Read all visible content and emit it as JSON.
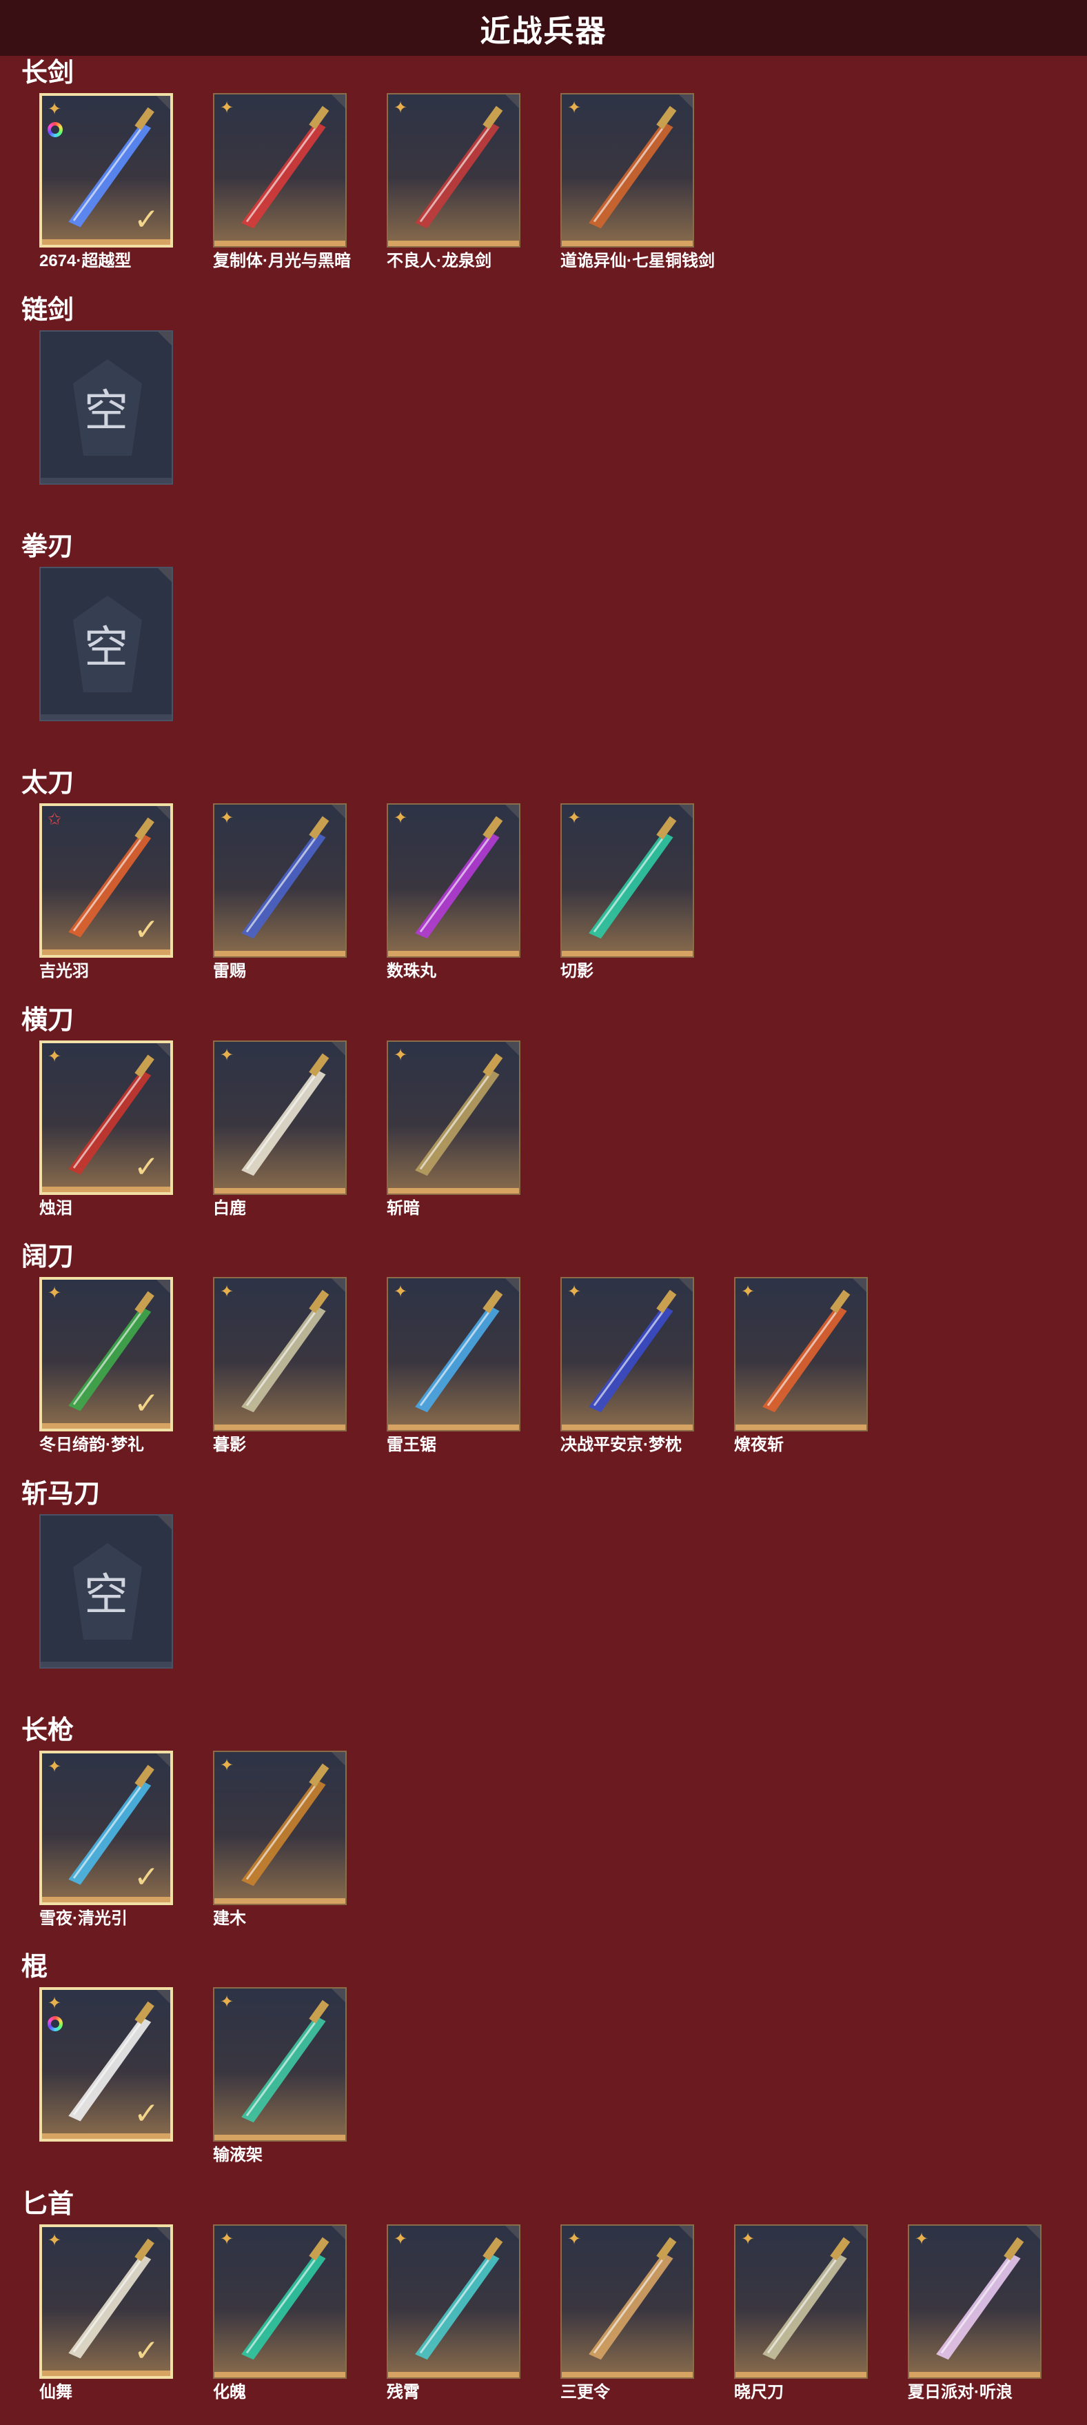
{
  "header": {
    "title": "近战兵器"
  },
  "colors": {
    "background": "#6b1b20",
    "header": "#3a0f13",
    "tile_top": "#2d3346",
    "tile_bottom_bar": "#d6a363",
    "equipped_border": "#f1dfa6"
  },
  "sections": [
    {
      "title": "长剑",
      "items": [
        {
          "name": "2674·超越型",
          "equipped": true,
          "rarity": "gold",
          "ring": true,
          "color": "#5b8cff"
        },
        {
          "name": "复制体·月光与黑暗",
          "equipped": false,
          "rarity": "gold",
          "color": "#d63a3a"
        },
        {
          "name": "不良人·龙泉剑",
          "equipped": false,
          "rarity": "gold",
          "color": "#c23b3b"
        },
        {
          "name": "道诡异仙·七星铜钱剑",
          "equipped": false,
          "rarity": "gold",
          "color": "#d0662e"
        }
      ]
    },
    {
      "title": "链剑",
      "items": [
        {
          "name": "",
          "empty": true,
          "empty_label": "空"
        }
      ]
    },
    {
      "title": "拳刃",
      "items": [
        {
          "name": "",
          "empty": true,
          "empty_label": "空"
        }
      ]
    },
    {
      "title": "太刀",
      "items": [
        {
          "name": "吉光羽",
          "equipped": true,
          "rarity": "red",
          "color": "#e0622e"
        },
        {
          "name": "雷赐",
          "equipped": false,
          "rarity": "gold",
          "color": "#4a63c8"
        },
        {
          "name": "数珠丸",
          "equipped": false,
          "rarity": "gold",
          "color": "#b33bd6"
        },
        {
          "name": "切影",
          "equipped": false,
          "rarity": "gold",
          "color": "#2ec9a3"
        }
      ]
    },
    {
      "title": "横刀",
      "items": [
        {
          "name": "烛泪",
          "equipped": true,
          "rarity": "gold",
          "color": "#c8352e"
        },
        {
          "name": "白鹿",
          "equipped": false,
          "rarity": "gold",
          "color": "#e8e2d0"
        },
        {
          "name": "斩暗",
          "equipped": false,
          "rarity": "gold",
          "color": "#b8a060"
        }
      ]
    },
    {
      "title": "阔刀",
      "items": [
        {
          "name": "冬日绮韵·梦礼",
          "equipped": true,
          "rarity": "gold",
          "color": "#3ea84a"
        },
        {
          "name": "暮影",
          "equipped": false,
          "rarity": "gold",
          "color": "#c8c2a0"
        },
        {
          "name": "雷王锯",
          "equipped": false,
          "rarity": "gold",
          "color": "#4aa8e8"
        },
        {
          "name": "决战平安京·梦枕",
          "equipped": false,
          "rarity": "gold",
          "color": "#3a4ac8"
        },
        {
          "name": "燎夜斩",
          "equipped": false,
          "rarity": "gold",
          "color": "#e0622e"
        }
      ]
    },
    {
      "title": "斩马刀",
      "items": [
        {
          "name": "",
          "empty": true,
          "empty_label": "空"
        }
      ]
    },
    {
      "title": "长枪",
      "items": [
        {
          "name": "雪夜·清光引",
          "equipped": true,
          "rarity": "gold",
          "color": "#4ab8e8"
        },
        {
          "name": "建木",
          "equipped": false,
          "rarity": "gold",
          "color": "#c8822e"
        }
      ]
    },
    {
      "title": "棍",
      "items": [
        {
          "name": "",
          "equipped": true,
          "rarity": "gold",
          "ring": true,
          "color": "#f0f0f0"
        },
        {
          "name": "输液架",
          "equipped": false,
          "rarity": "gold",
          "color": "#3ec8a3"
        }
      ]
    },
    {
      "title": "匕首",
      "items": [
        {
          "name": "仙舞",
          "equipped": true,
          "rarity": "gold",
          "color": "#e8e2d0"
        },
        {
          "name": "化魄",
          "equipped": false,
          "rarity": "gold",
          "color": "#2ec9a3"
        },
        {
          "name": "残霄",
          "equipped": false,
          "rarity": "gold",
          "color": "#4ac8c8"
        },
        {
          "name": "三更令",
          "equipped": false,
          "rarity": "gold",
          "color": "#d6a363"
        },
        {
          "name": "晓尺刀",
          "equipped": false,
          "rarity": "gold",
          "color": "#c8c2a0"
        },
        {
          "name": "夏日派对·听浪",
          "equipped": false,
          "rarity": "gold",
          "color": "#e8c8f0"
        }
      ]
    }
  ]
}
